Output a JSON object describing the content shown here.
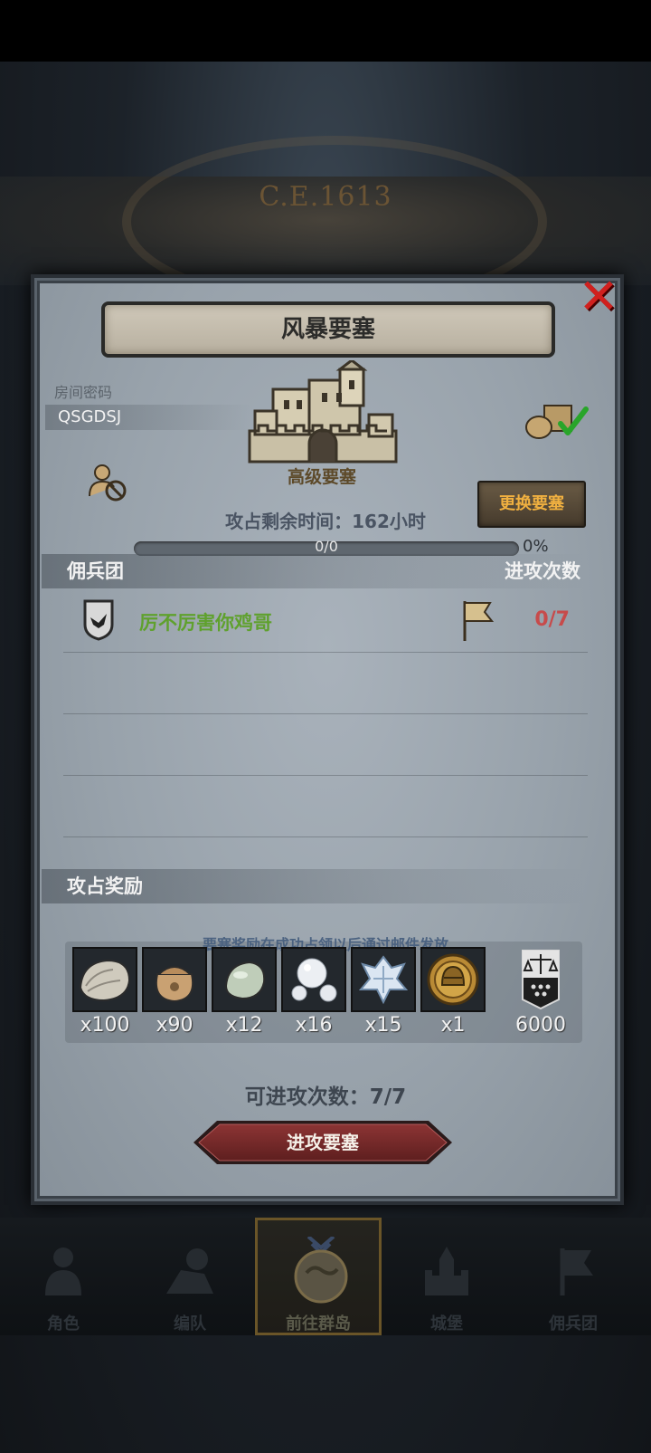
{
  "background": {
    "year": "C.E.1613"
  },
  "dialog": {
    "title": "风暴要塞",
    "room_code_label": "房间密码",
    "room_code": "QSGDSJ",
    "fortress_level": "高级要塞",
    "change_button": "更换要塞",
    "time_label": "攻占剩余时间：",
    "time_value": "162小时",
    "progress_text": "0/0",
    "progress_percent": "0%",
    "progress_fraction": 0,
    "merc_header": "佣兵团",
    "attack_count_header": "进攻次数",
    "mercenaries": [
      {
        "name": "厉不厉害你鸡哥",
        "attacks": "0/7"
      }
    ],
    "rewards_header": "攻占奖励",
    "rewards_note": "要塞奖励在成功占领以后通过邮件发放",
    "rewards": [
      {
        "icon": "oyster-icon",
        "qty": "x100"
      },
      {
        "icon": "pouch-icon",
        "qty": "x90"
      },
      {
        "icon": "stone-icon",
        "qty": "x12"
      },
      {
        "icon": "pearls-icon",
        "qty": "x16"
      },
      {
        "icon": "crystal-icon",
        "qty": "x15"
      },
      {
        "icon": "helmet-medal-icon",
        "qty": "x1"
      },
      {
        "icon": "guild-banner-icon",
        "qty": "6000"
      }
    ],
    "attacks_left": "可进攻次数：7/7",
    "attack_button": "进攻要塞"
  },
  "nav": [
    {
      "label": "角色",
      "icon": "character-icon"
    },
    {
      "label": "编队",
      "icon": "formation-icon"
    },
    {
      "label": "前往群岛",
      "icon": "islands-icon",
      "active": true
    },
    {
      "label": "城堡",
      "icon": "castle-icon"
    },
    {
      "label": "佣兵团",
      "icon": "mercenary-icon"
    }
  ],
  "colors": {
    "merc_name": "#5fa12d",
    "attack_count": "#c74b4b",
    "change_button_text": "#f0b040",
    "attack_button": "#7a2a2a"
  }
}
